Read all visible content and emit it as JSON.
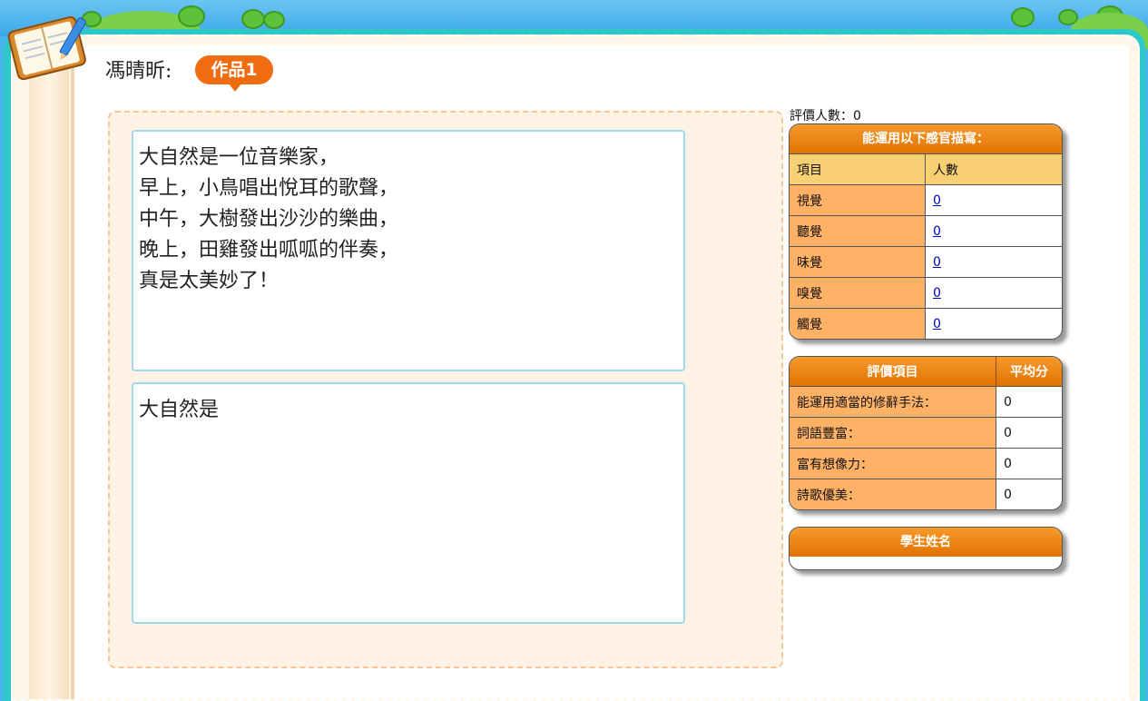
{
  "header": {
    "author": "馮晴昕:",
    "work_badge": "作品1"
  },
  "poem": {
    "text": "大自然是一位音樂家，\n早上，小鳥唱出悅耳的歌聲，\n中午，大樹發出沙沙的樂曲，\n晚上，田雞發出呱呱的伴奏，\n真是太美妙了！",
    "draft": "大自然是"
  },
  "rater_count": "評價人數：0",
  "senses_panel": {
    "title": "能運用以下感官描寫：",
    "col_item": "項目",
    "col_count": "人數",
    "rows": [
      {
        "label": "視覺",
        "count": "0"
      },
      {
        "label": "聽覺",
        "count": "0"
      },
      {
        "label": "味覺",
        "count": "0"
      },
      {
        "label": "嗅覺",
        "count": "0"
      },
      {
        "label": "觸覺",
        "count": "0"
      }
    ]
  },
  "rating_panel": {
    "col_item": "評價項目",
    "col_avg": "平均分",
    "rows": [
      {
        "label": "能運用適當的修辭手法：",
        "value": "0"
      },
      {
        "label": "詞語豐富：",
        "value": "0"
      },
      {
        "label": "富有想像力：",
        "value": "0"
      },
      {
        "label": "詩歌優美：",
        "value": "0"
      }
    ]
  },
  "students_panel": {
    "title": "學生姓名"
  },
  "colors": {
    "frame": "#2fc8c8",
    "accent_orange": "#f06c10",
    "label_cell": "#ffb266",
    "textbox_border": "#9ed8ec"
  }
}
